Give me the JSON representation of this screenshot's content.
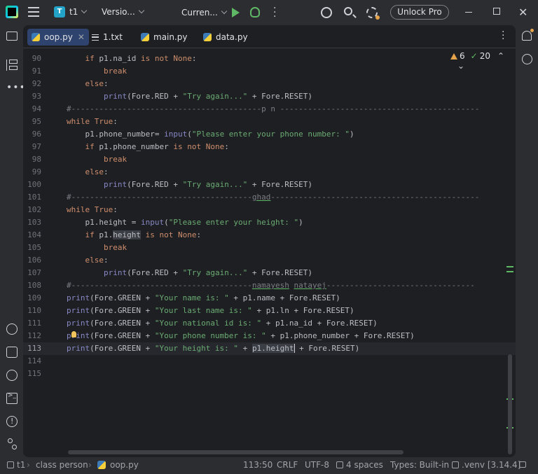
{
  "titlebar": {
    "project_badge": "T",
    "project_name": "t1",
    "vcs_label": "Versio...",
    "run_config": "Curren...",
    "unlock_label": "Unlock Pro"
  },
  "tabs": [
    {
      "label": "oop.py",
      "icon": "python-file-icon",
      "active": true
    },
    {
      "label": "1.txt",
      "icon": "text-file-icon",
      "active": false
    },
    {
      "label": "main.py",
      "icon": "python-file-icon",
      "active": false
    },
    {
      "label": "data.py",
      "icon": "python-file-icon",
      "active": false
    }
  ],
  "inspections": {
    "warnings": "6",
    "ok": "20"
  },
  "code": {
    "current_line": 113,
    "lines": [
      {
        "n": "90",
        "tokens": [
          [
            "",
            "    "
          ],
          [
            "kw",
            "if"
          ],
          [
            "",
            " p1.na_id "
          ],
          [
            "kw",
            "is not None"
          ],
          [
            "",
            ":"
          ]
        ]
      },
      {
        "n": "91",
        "tokens": [
          [
            "",
            "        "
          ],
          [
            "kw",
            "break"
          ]
        ]
      },
      {
        "n": "92",
        "tokens": [
          [
            "",
            "    "
          ],
          [
            "kw",
            "else"
          ],
          [
            "",
            ":"
          ]
        ]
      },
      {
        "n": "93",
        "tokens": [
          [
            "",
            "        "
          ],
          [
            "bi",
            "print"
          ],
          [
            "",
            "(Fore.RED + "
          ],
          [
            "str",
            "\"Try again...\""
          ],
          [
            "",
            " + Fore.RESET)"
          ]
        ]
      },
      {
        "n": "94",
        "tokens": [
          [
            "cm",
            "#-----------------------------------------p n -------------------------------------------"
          ]
        ]
      },
      {
        "n": "95",
        "tokens": [
          [
            "kw",
            "while"
          ],
          [
            "",
            " "
          ],
          [
            "kw",
            "True"
          ],
          [
            "",
            ":"
          ]
        ]
      },
      {
        "n": "96",
        "tokens": [
          [
            "",
            "    p1.phone_number= "
          ],
          [
            "bi",
            "input"
          ],
          [
            "",
            "("
          ],
          [
            "str",
            "\"Please enter your phone number: \""
          ],
          [
            "",
            ")"
          ]
        ]
      },
      {
        "n": "97",
        "tokens": [
          [
            "",
            "    "
          ],
          [
            "kw",
            "if"
          ],
          [
            "",
            " p1.phone_number "
          ],
          [
            "kw",
            "is not None"
          ],
          [
            "",
            ":"
          ]
        ]
      },
      {
        "n": "98",
        "tokens": [
          [
            "",
            "        "
          ],
          [
            "kw",
            "break"
          ]
        ]
      },
      {
        "n": "99",
        "tokens": [
          [
            "",
            "    "
          ],
          [
            "kw",
            "else"
          ],
          [
            "",
            ":"
          ]
        ]
      },
      {
        "n": "100",
        "tokens": [
          [
            "",
            "        "
          ],
          [
            "bi",
            "print"
          ],
          [
            "",
            "(Fore.RED + "
          ],
          [
            "str",
            "\"Try again...\""
          ],
          [
            "",
            " + Fore.RESET)"
          ]
        ]
      },
      {
        "n": "101",
        "tokens": [
          [
            "cm",
            "#---------------------------------------"
          ],
          [
            "cm-u",
            "ghad"
          ],
          [
            "cm",
            "---------------------------------------------"
          ]
        ]
      },
      {
        "n": "102",
        "tokens": [
          [
            "kw",
            "while"
          ],
          [
            "",
            " "
          ],
          [
            "kw",
            "True"
          ],
          [
            "",
            ":"
          ]
        ]
      },
      {
        "n": "103",
        "tokens": [
          [
            "",
            "    p1.height = "
          ],
          [
            "bi",
            "input"
          ],
          [
            "",
            "("
          ],
          [
            "str",
            "\"Please enter your height: \""
          ],
          [
            "",
            ")"
          ]
        ]
      },
      {
        "n": "104",
        "tokens": [
          [
            "",
            "    "
          ],
          [
            "kw",
            "if"
          ],
          [
            "",
            " p1."
          ],
          [
            "hl",
            "height"
          ],
          [
            "",
            " "
          ],
          [
            "kw",
            "is not None"
          ],
          [
            "",
            ":"
          ]
        ]
      },
      {
        "n": "105",
        "tokens": [
          [
            "",
            "        "
          ],
          [
            "kw",
            "break"
          ]
        ]
      },
      {
        "n": "106",
        "tokens": [
          [
            "",
            "    "
          ],
          [
            "kw",
            "else"
          ],
          [
            "",
            ":"
          ]
        ]
      },
      {
        "n": "107",
        "tokens": [
          [
            "",
            "        "
          ],
          [
            "bi",
            "print"
          ],
          [
            "",
            "(Fore.RED + "
          ],
          [
            "str",
            "\"Try again...\""
          ],
          [
            "",
            " + Fore.RESET)"
          ]
        ]
      },
      {
        "n": "108",
        "tokens": [
          [
            "cm",
            "#---------------------------------------"
          ],
          [
            "cm-u",
            "namayesh"
          ],
          [
            "cm",
            " "
          ],
          [
            "cm-u",
            "natayej"
          ],
          [
            "cm",
            "--------------------------------"
          ]
        ]
      },
      {
        "n": "109",
        "tokens": [
          [
            "bi",
            "print"
          ],
          [
            "",
            "(Fore.GREEN + "
          ],
          [
            "str",
            "\"Your name is: \""
          ],
          [
            "",
            " + p1.name + Fore.RESET)"
          ]
        ]
      },
      {
        "n": "110",
        "tokens": [
          [
            "bi",
            "print"
          ],
          [
            "",
            "(Fore.GREEN + "
          ],
          [
            "str",
            "\"Your last name is: \""
          ],
          [
            "",
            " + p1.ln + Fore.RESET)"
          ]
        ]
      },
      {
        "n": "111",
        "tokens": [
          [
            "bi",
            "print"
          ],
          [
            "",
            "(Fore.GREEN + "
          ],
          [
            "str",
            "\"Your national id is: \""
          ],
          [
            "",
            " + p1.na_id + Fore.RESET)"
          ]
        ]
      },
      {
        "n": "112",
        "tokens": [
          [
            "bi",
            "print"
          ],
          [
            "",
            "(Fore.GREEN + "
          ],
          [
            "str",
            "\"Your phone number is: \""
          ],
          [
            "",
            " + p1.phone_number + Fore.RESET)"
          ]
        ]
      },
      {
        "n": "113",
        "tokens": [
          [
            "bi",
            "print"
          ],
          [
            "",
            "(Fore.GREEN + "
          ],
          [
            "str",
            "\"Your height is: \""
          ],
          [
            "",
            " + "
          ],
          [
            "hl",
            "p1.height"
          ],
          [
            "caret",
            ""
          ],
          [
            "",
            " + Fore.RESET)"
          ]
        ]
      },
      {
        "n": "114",
        "tokens": []
      },
      {
        "n": "115",
        "tokens": []
      }
    ]
  },
  "statusbar": {
    "project": "t1",
    "breadcrumb_class": "class person",
    "file": "oop.py",
    "position": "113:50",
    "line_sep": "CRLF",
    "encoding": "UTF-8",
    "indent": "4 spaces",
    "types": "Types: Built-in",
    "interpreter": ".venv [3.14.4]"
  },
  "colors": {
    "keyword": "#cf8e6d",
    "string": "#6aab73",
    "builtin": "#8888c6",
    "comment": "#7a7e85",
    "tab_active": "#2e436e",
    "run_green": "#5fb865",
    "warning": "#e5a34b"
  }
}
